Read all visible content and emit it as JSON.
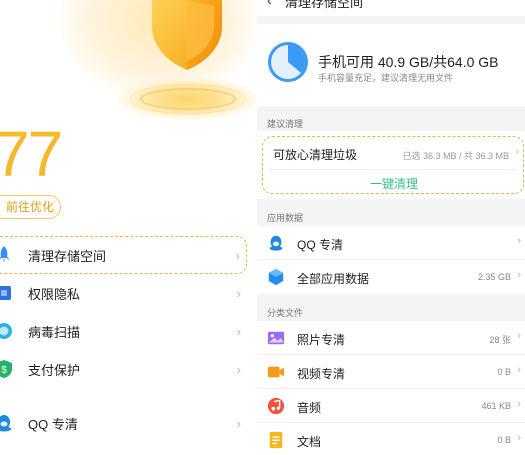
{
  "left": {
    "score": "77",
    "optimize_button": "前往优化",
    "menu": [
      {
        "label": "清理存储空间",
        "icon": "rocket-icon",
        "highlight": true
      },
      {
        "label": "权限隐私",
        "icon": "privacy-icon"
      },
      {
        "label": "病毒扫描",
        "icon": "virus-scan-icon"
      },
      {
        "label": "支付保护",
        "icon": "payment-shield-icon"
      },
      {
        "label": "QQ 专清",
        "icon": "qq-icon"
      }
    ],
    "chevron": "›"
  },
  "right": {
    "page_title": "清理存储空间",
    "back": "‹",
    "storage": {
      "main": "手机可用 40.9 GB/共64.0 GB",
      "sub": "手机容量充足，建议清理无用文件",
      "available_gb": 40.9,
      "total_gb": 64.0
    },
    "suggest_section": "建议清理",
    "suggest": {
      "title": "可放心清理垃圾",
      "value": "已选 36.3 MB / 共 36.3 MB",
      "action": "一键清理"
    },
    "app_section": "应用数据",
    "app_rows": [
      {
        "label": "QQ 专清",
        "value": "",
        "icon": "qq-icon"
      },
      {
        "label": "全部应用数据",
        "value": "2.35 GB",
        "icon": "cube-icon"
      }
    ],
    "files_section": "分类文件",
    "file_rows": [
      {
        "label": "照片专清",
        "value": "28 张",
        "icon": "photo-icon"
      },
      {
        "label": "视频专清",
        "value": "0 B",
        "icon": "video-icon"
      },
      {
        "label": "音频",
        "value": "461 KB",
        "icon": "music-icon"
      },
      {
        "label": "文档",
        "value": "0 B",
        "icon": "document-icon"
      }
    ],
    "chevron": "›"
  },
  "colors": {
    "accent_orange": "#f7b82c",
    "green_action": "#3cc08a",
    "blue_icon": "#3a8ef0"
  }
}
